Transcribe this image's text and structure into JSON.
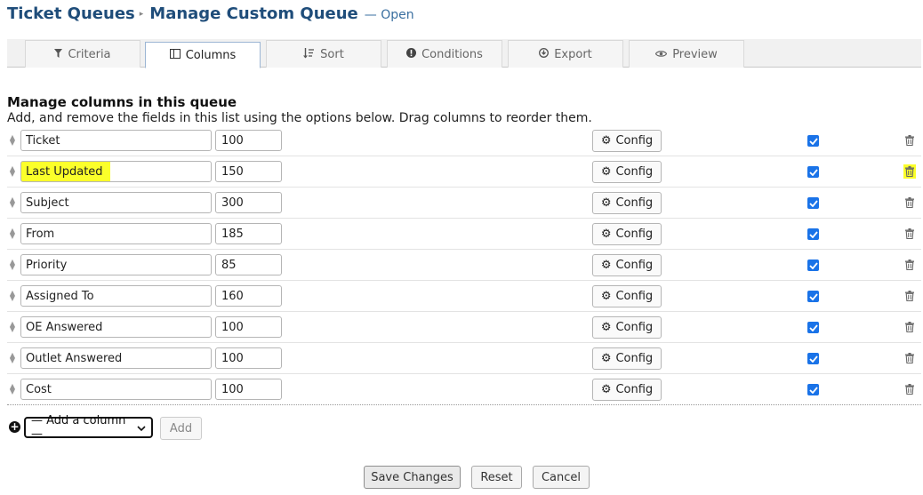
{
  "breadcrumb": {
    "parent": "Ticket Queues",
    "current": "Manage Custom Queue",
    "status": "— Open"
  },
  "tabs": [
    {
      "label": "Criteria",
      "icon": "filter-icon",
      "active": false
    },
    {
      "label": "Columns",
      "icon": "columns-icon",
      "active": true
    },
    {
      "label": "Sort",
      "icon": "sort-icon",
      "active": false
    },
    {
      "label": "Conditions",
      "icon": "info-icon",
      "active": false
    },
    {
      "label": "Export",
      "icon": "export-icon",
      "active": false
    },
    {
      "label": "Preview",
      "icon": "eye-icon",
      "active": false
    }
  ],
  "section": {
    "title": "Manage columns in this queue",
    "description": "Add, and remove the fields in this list using the options below. Drag columns to reorder them."
  },
  "columns": [
    {
      "name": "Ticket",
      "width": "100",
      "config_label": "Config",
      "visible": true
    },
    {
      "name": "Last Updated",
      "width": "150",
      "config_label": "Config",
      "visible": true
    },
    {
      "name": "Subject",
      "width": "300",
      "config_label": "Config",
      "visible": true
    },
    {
      "name": "From",
      "width": "185",
      "config_label": "Config",
      "visible": true
    },
    {
      "name": "Priority",
      "width": "85",
      "config_label": "Config",
      "visible": true
    },
    {
      "name": "Assigned To",
      "width": "160",
      "config_label": "Config",
      "visible": true
    },
    {
      "name": "OE Answered",
      "width": "100",
      "config_label": "Config",
      "visible": true
    },
    {
      "name": "Outlet Answered",
      "width": "100",
      "config_label": "Config",
      "visible": true
    },
    {
      "name": "Cost",
      "width": "100",
      "config_label": "Config",
      "visible": true
    }
  ],
  "add_column": {
    "select_value": "— Add a column —",
    "button_label": "Add"
  },
  "actions": {
    "save": "Save Changes",
    "reset": "Reset",
    "cancel": "Cancel"
  },
  "colors": {
    "heading": "#1f4d7a",
    "highlight": "#fbff2a",
    "checkbox": "#1a73e8"
  }
}
